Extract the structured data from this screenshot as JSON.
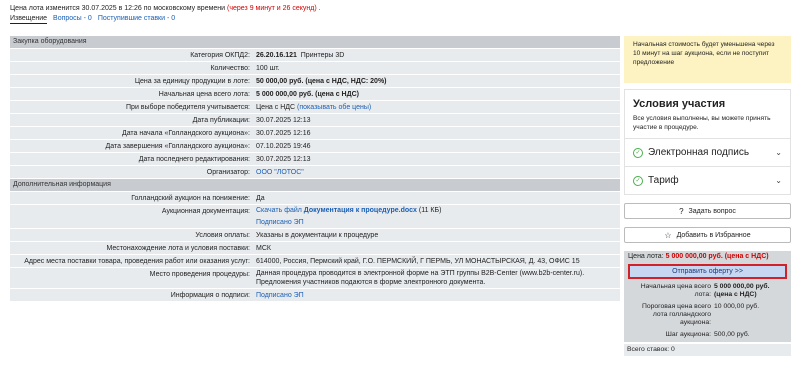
{
  "header": {
    "price_change": "Цена лота изменится 30.07.2025 в 12:26 по московскому времени",
    "countdown": "(через 9 минут и 26 секунд)",
    "tail": "."
  },
  "tabs": [
    {
      "label": "Извещение"
    },
    {
      "label": "Вопросы - 0"
    },
    {
      "label": "Поступившие ставки - 0"
    }
  ],
  "section1": {
    "title": "Закупка оборудования",
    "rows": {
      "okpd_label": "Категория ОКПД2:",
      "okpd_code": "26.20.16.121",
      "okpd_name": "Принтеры 3D",
      "qty_label": "Количество:",
      "qty_value": "100 шт.",
      "unit_price_label": "Цена за единицу продукции в лоте:",
      "unit_price_value": "50 000,00 руб. (цена с НДС, НДС: 20%)",
      "start_price_label": "Начальная цена всего лота:",
      "start_price_value": "5 000 000,00 руб. (цена с НДС)",
      "winner_label": "При выборе победителя учитывается:",
      "winner_value": "Цена с НДС",
      "winner_link": "(показывать обе цены)",
      "pub_label": "Дата публикации:",
      "pub_value": "30.07.2025 12:13",
      "start_label": "Дата начала «Голландского аукциона»:",
      "start_value": "30.07.2025 12:16",
      "end_label": "Дата завершения «Голландского аукциона»:",
      "end_value": "07.10.2025 19:46",
      "edit_label": "Дата последнего редактирования:",
      "edit_value": "30.07.2025 12:13",
      "org_label": "Организатор:",
      "org_value": "ООО \"ЛОТОС\""
    }
  },
  "section2": {
    "title": "Дополнительная информация",
    "rows": {
      "dutch_label": "Голландский аукцион на понижение:",
      "dutch_value": "Да",
      "docs_label": "Аукционная документация:",
      "docs_download": "Скачать файл",
      "docs_file": "Документация к процедуре.docx",
      "docs_size": "(11 КБ)",
      "docs_signed": "Подписано ЭП",
      "pay_label": "Условия оплаты:",
      "pay_value": "Указаны в документации к процедуре",
      "loc_label": "Местонахождение лота и условия поставки:",
      "loc_value": "МСК",
      "addr_label": "Адрес места поставки товара, проведения работ или оказания услуг:",
      "addr_value": "614000, Россия, Пермский край, Г.О. ПЕРМСКИЙ, Г ПЕРМЬ, УЛ МОНАСТЫРСКАЯ, Д. 43, ОФИС 15",
      "place_label": "Место проведения процедуры:",
      "place_value1": "Данная процедура проводится в электронной форме на ЭТП группы B2B-Center (www.b2b-center.ru).",
      "place_value2": "Предложения участников подаются в форме электронного документа.",
      "sign_label": "Информация о подписи:",
      "sign_value": "Подписано ЭП"
    }
  },
  "sidebar": {
    "notice": "Начальная стоимость будет уменьшена через 10 минут на шаг аукциона, если не поступит предложение",
    "conditions_title": "Условия участия",
    "conditions_text": "Все условия выполнены, вы можете принять участие в процедуре.",
    "cond_items": [
      {
        "label": "Электронная подпись"
      },
      {
        "label": "Тариф"
      }
    ],
    "ask_button": "Задать вопрос",
    "fav_button": "Добавить в Избранное",
    "price_prefix": "Цена лота:",
    "price_value": "5 000 000,00 руб. (цена с НДС)",
    "offer_button": "Отправить оферту >>",
    "start_price_label": "Начальная цена всего лота:",
    "start_price_value": "5 000 000,00 руб.",
    "start_price_note": "(цена с НДС)",
    "cutoff_label": "Пороговая цена всего лота голландского аукциона:",
    "cutoff_value": "10 000,00 руб.",
    "step_label": "Шаг аукциона:",
    "step_value": "500,00 руб.",
    "bids_label": "Всего ставок: 0"
  }
}
